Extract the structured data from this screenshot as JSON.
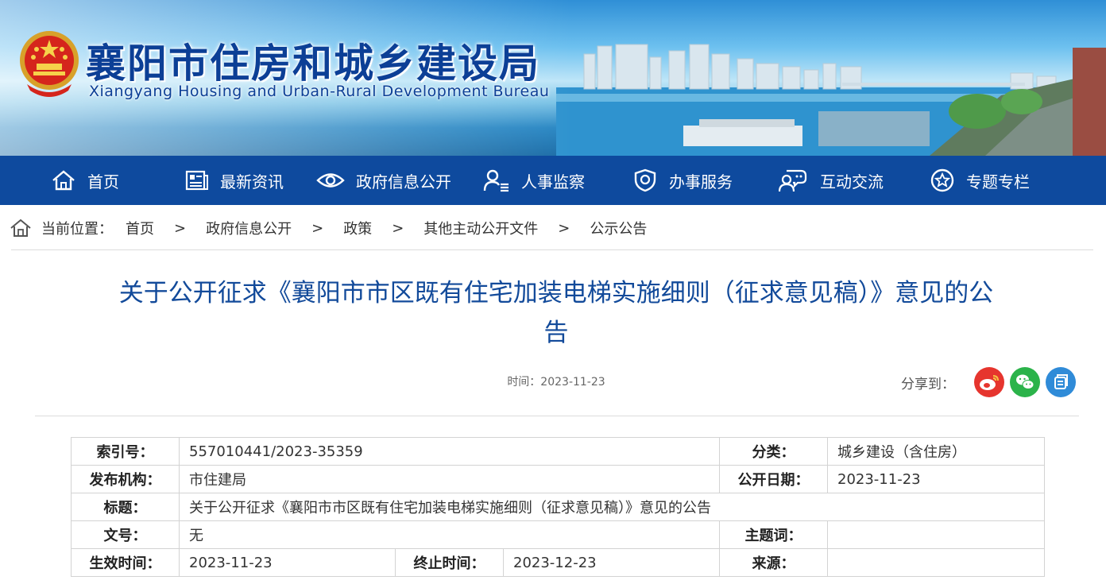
{
  "header": {
    "site_title": "襄阳市住房和城乡建设局",
    "site_subtitle": "Xiangyang  Housing and Urban-Rural Development Bureau"
  },
  "nav": {
    "items": [
      {
        "label": "首页",
        "icon": "home-icon"
      },
      {
        "label": "最新资讯",
        "icon": "news-icon"
      },
      {
        "label": "政府信息公开",
        "icon": "eye-icon"
      },
      {
        "label": "人事监察",
        "icon": "person-list-icon"
      },
      {
        "label": "办事服务",
        "icon": "shield-icon"
      },
      {
        "label": "互动交流",
        "icon": "chat-people-icon"
      },
      {
        "label": "专题专栏",
        "icon": "star-badge-icon"
      }
    ]
  },
  "breadcrumb": {
    "prefix": "当前位置：",
    "separator": ">",
    "items": [
      "首页",
      "政府信息公开",
      "政策",
      "其他主动公开文件",
      "公示公告"
    ]
  },
  "article": {
    "title_line1": "关于公开征求《襄阳市市区既有住宅加装电梯实施细则（征求意见稿）》意见的公",
    "title_line2": "告",
    "time": "时间：2023-11-23",
    "share_label": "分享到：",
    "share": [
      {
        "name": "weibo",
        "icon": "weibo-icon",
        "color": "#e6352e"
      },
      {
        "name": "wechat",
        "icon": "wechat-icon",
        "color": "#2bb34a"
      },
      {
        "name": "qzone",
        "icon": "qzone-icon",
        "color": "#2f8bd8"
      }
    ]
  },
  "info_table": {
    "index_no_label": "索引号：",
    "index_no": "557010441/2023-35359",
    "category_label": "分类：",
    "category": "城乡建设（含住房）",
    "publisher_label": "发布机构：",
    "publisher": "市住建局",
    "pub_date_label": "公开日期：",
    "pub_date": "2023-11-23",
    "title_label": "标题：",
    "title": "关于公开征求《襄阳市市区既有住宅加装电梯实施细则（征求意见稿）》意见的公告",
    "doc_no_label": "文号：",
    "doc_no": "无",
    "keywords_label": "主题词：",
    "keywords": "",
    "effective_label": "生效时间：",
    "effective": "2023-11-23",
    "end_label": "终止时间：",
    "end": "2023-12-23",
    "source_label": "来源：",
    "source": ""
  }
}
